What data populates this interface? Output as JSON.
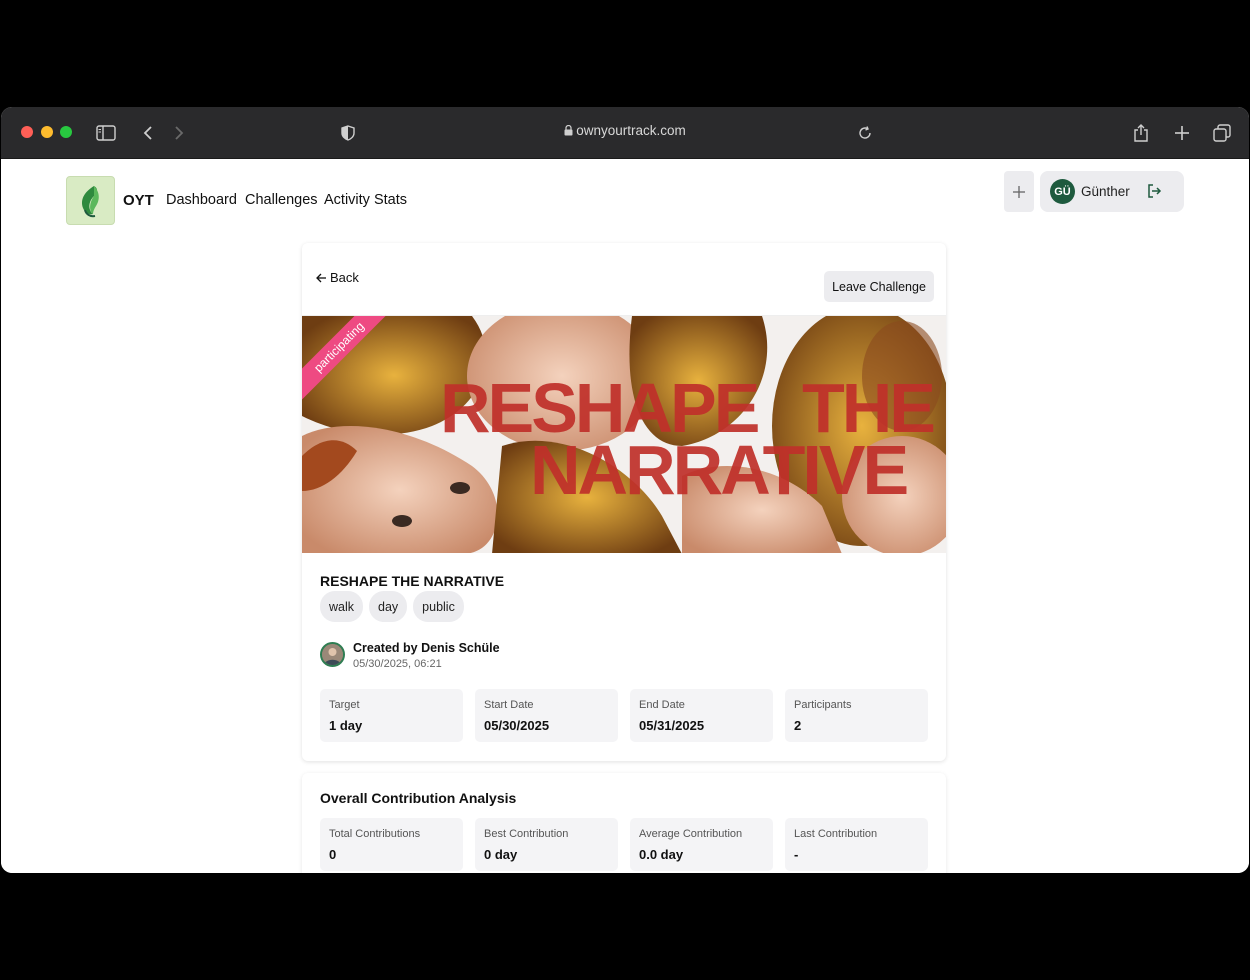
{
  "browser": {
    "url": "ownyourtrack.com"
  },
  "nav": {
    "brand": "OYT",
    "links": [
      "Dashboard",
      "Challenges",
      "Activity Stats"
    ],
    "user": {
      "initials": "GÜ",
      "name": "Günther"
    }
  },
  "challenge": {
    "back_label": "Back",
    "leave_label": "Leave Challenge",
    "ribbon": "participating",
    "banner_text": [
      "RESHAPE",
      "THE",
      "NARRATIVE"
    ],
    "title": "RESHAPE THE NARRATIVE",
    "tags": [
      "walk",
      "day",
      "public"
    ],
    "creator": "Created by Denis Schüle",
    "created_at": "05/30/2025, 06:21",
    "stats": [
      {
        "label": "Target",
        "value": "1 day"
      },
      {
        "label": "Start Date",
        "value": "05/30/2025"
      },
      {
        "label": "End Date",
        "value": "05/31/2025"
      },
      {
        "label": "Participants",
        "value": "2"
      }
    ]
  },
  "analysis": {
    "title": "Overall Contribution Analysis",
    "stats": [
      {
        "label": "Total Contributions",
        "value": "0"
      },
      {
        "label": "Best Contribution",
        "value": "0 day"
      },
      {
        "label": "Average Contribution",
        "value": "0.0 day"
      },
      {
        "label": "Last Contribution",
        "value": "-"
      }
    ]
  },
  "colors": {
    "accent_green": "#1e5a3e",
    "ribbon_pink": "#ee4a82",
    "banner_red": "#c0302a"
  }
}
